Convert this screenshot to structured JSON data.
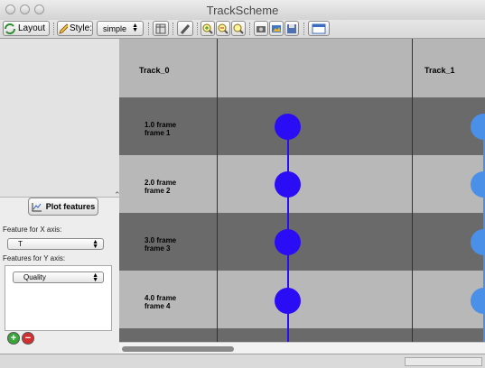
{
  "window": {
    "title": "TrackScheme"
  },
  "toolbar": {
    "layout_label": "Layout",
    "style_label": "Style:",
    "style_value": "simple"
  },
  "left_panel": {
    "plot_button_label": "Plot features",
    "x_axis_label": "Feature for X axis:",
    "x_axis_value": "T",
    "y_axis_label": "Features for Y axis:",
    "y_axis_value": "Quality"
  },
  "grid": {
    "columns": [
      {
        "label": "Track_0"
      },
      {
        "label": "Track_1"
      }
    ],
    "rows": [
      {
        "label": "1.0 frame\nframe 1"
      },
      {
        "label": "2.0 frame\nframe 2"
      },
      {
        "label": "3.0 frame\nframe 3"
      },
      {
        "label": "4.0 frame\nframe 4"
      }
    ]
  },
  "colors": {
    "spot_track0": "#2a0df5",
    "spot_track1": "#4a8fe8",
    "row_dark": "#6a6a6a",
    "row_light": "#b8b8b8"
  }
}
